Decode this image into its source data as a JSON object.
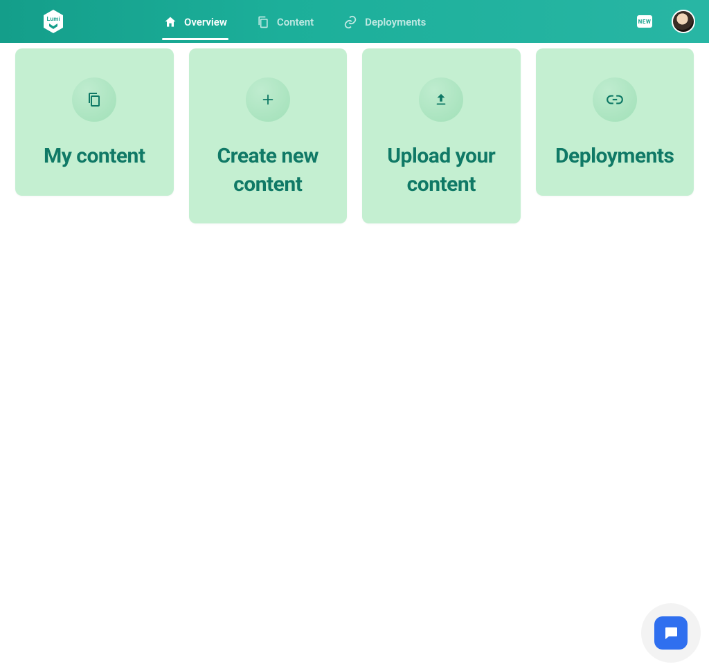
{
  "brand": {
    "name": "Lumi"
  },
  "nav": {
    "overview": {
      "label": "Overview",
      "active": true
    },
    "content": {
      "label": "Content",
      "active": false
    },
    "deployments": {
      "label": "Deployments",
      "active": false
    }
  },
  "header": {
    "new_badge": "NEW"
  },
  "cards": {
    "my_content": {
      "title": "My content",
      "icon": "copy-icon"
    },
    "create_new": {
      "title": "Create new content",
      "icon": "plus-icon"
    },
    "upload": {
      "title": "Upload your content",
      "icon": "upload-icon"
    },
    "deployments": {
      "title": "Deployments",
      "icon": "link-icon"
    }
  },
  "colors": {
    "header_gradient_start": "#149e8a",
    "header_gradient_end": "#28b6a4",
    "card_bg": "#c4efd1",
    "card_title": "#107966",
    "chat_fab": "#2f6fef"
  }
}
